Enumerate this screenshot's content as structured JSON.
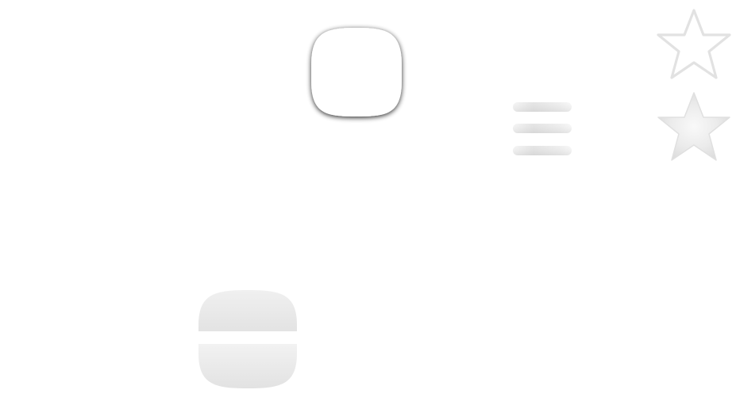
{
  "canvas": {
    "background": "#ffffff"
  },
  "icons": [
    {
      "name": "rounded-square-icon",
      "style": "white fill with dark drop shadow",
      "fill": "#ffffff",
      "shadow": "#000000"
    },
    {
      "name": "hamburger-menu-icon",
      "style": "three horizontal bars, light grey gradient",
      "color": "#e2e2e2"
    },
    {
      "name": "star-outline-icon",
      "style": "outlined star, light grey stroke",
      "color": "#e4e4e4"
    },
    {
      "name": "star-filled-icon",
      "style": "filled star, radial light grey gradient",
      "color": "#e6e6e6"
    },
    {
      "name": "split-rounded-tile-icon",
      "style": "rounded tile with horizontal white split, grey gradient",
      "color": "#e8e8e8"
    }
  ]
}
